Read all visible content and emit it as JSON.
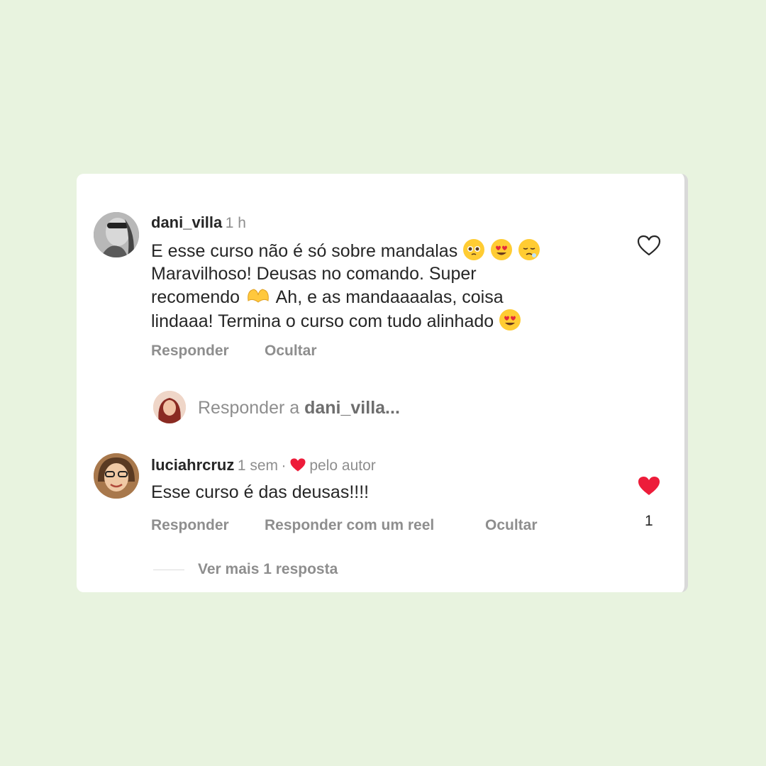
{
  "comment1": {
    "username": "dani_villa",
    "time": "1 h",
    "line1": "E esse curso não é só sobre mandalas",
    "line2": "Maravilhoso! Deusas no comando. Super",
    "line3a": "recomendo",
    "line3b": "Ah, e as mandaaaalas, coisa",
    "line4": "lindaaa! Termina o curso com tudo alinhado",
    "reply_label": "Responder",
    "hide_label": "Ocultar",
    "emojis": [
      "pleading-face",
      "heart-eyes",
      "relieved-drooling",
      "heart-hands",
      "heart-eyes"
    ]
  },
  "reply_input": {
    "prefix": "Responder a ",
    "target": "dani_villa..."
  },
  "comment2": {
    "username": "luciahrcruz",
    "time": "1 sem",
    "separator": "·",
    "liked_by_author": "pelo autor",
    "text": "Esse curso é das deusas!!!!",
    "reply_label": "Responder",
    "reel_label": "Responder com um reel",
    "hide_label": "Ocultar",
    "like_count": "1"
  },
  "view_more": "Ver mais 1 resposta",
  "colors": {
    "background": "#e8f3df",
    "card": "#ffffff",
    "like_red": "#ed1c3a",
    "muted": "#8e8e8e",
    "text": "#262626"
  }
}
